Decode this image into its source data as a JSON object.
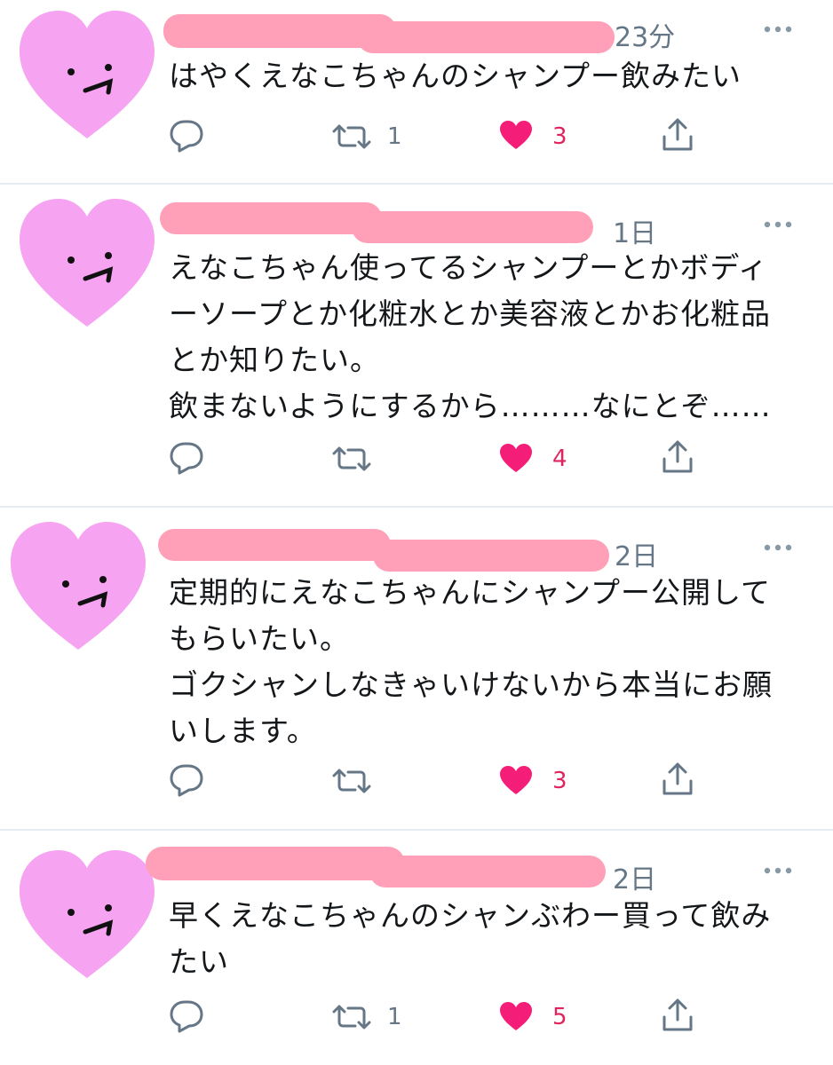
{
  "tweets": [
    {
      "time": "23分",
      "text": "はやくえなこちゃんのシャンプー飲みたい",
      "retweets": "1",
      "likes": "3"
    },
    {
      "time": "1日",
      "text": "えなこちゃん使ってるシャンプーとかボディ\nーソープとか化粧水とか美容液とかお化粧品\nとか知りたい。\n飲まないようにするから………なにとぞ……",
      "retweets": "",
      "likes": "4"
    },
    {
      "time": "2日",
      "text": "定期的にえなこちゃんにシャンプー公開して\nもらいたい。\nゴクシャンしなきゃいけないから本当にお願\nいします。",
      "retweets": "",
      "likes": "3"
    },
    {
      "time": "2日",
      "text": "早くえなこちゃんのシャンぶわー買って飲み\nたい",
      "retweets": "1",
      "likes": "5"
    }
  ],
  "icons": {
    "reply": "reply-icon",
    "retweet": "retweet-icon",
    "like": "heart-icon",
    "share": "share-icon",
    "more": "more-icon"
  },
  "colors": {
    "like": "#f41e78",
    "avatar": "#f6a3f2",
    "redaction": "#ff9fb8",
    "muted": "#657786"
  }
}
